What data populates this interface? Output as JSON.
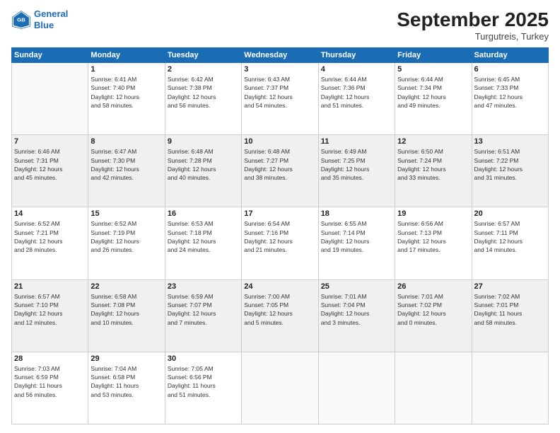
{
  "header": {
    "logo_line1": "General",
    "logo_line2": "Blue",
    "month": "September 2025",
    "location": "Turgutreis, Turkey"
  },
  "weekdays": [
    "Sunday",
    "Monday",
    "Tuesday",
    "Wednesday",
    "Thursday",
    "Friday",
    "Saturday"
  ],
  "weeks": [
    [
      {
        "day": "",
        "info": ""
      },
      {
        "day": "1",
        "info": "Sunrise: 6:41 AM\nSunset: 7:40 PM\nDaylight: 12 hours\nand 58 minutes."
      },
      {
        "day": "2",
        "info": "Sunrise: 6:42 AM\nSunset: 7:38 PM\nDaylight: 12 hours\nand 56 minutes."
      },
      {
        "day": "3",
        "info": "Sunrise: 6:43 AM\nSunset: 7:37 PM\nDaylight: 12 hours\nand 54 minutes."
      },
      {
        "day": "4",
        "info": "Sunrise: 6:44 AM\nSunset: 7:36 PM\nDaylight: 12 hours\nand 51 minutes."
      },
      {
        "day": "5",
        "info": "Sunrise: 6:44 AM\nSunset: 7:34 PM\nDaylight: 12 hours\nand 49 minutes."
      },
      {
        "day": "6",
        "info": "Sunrise: 6:45 AM\nSunset: 7:33 PM\nDaylight: 12 hours\nand 47 minutes."
      }
    ],
    [
      {
        "day": "7",
        "info": "Sunrise: 6:46 AM\nSunset: 7:31 PM\nDaylight: 12 hours\nand 45 minutes."
      },
      {
        "day": "8",
        "info": "Sunrise: 6:47 AM\nSunset: 7:30 PM\nDaylight: 12 hours\nand 42 minutes."
      },
      {
        "day": "9",
        "info": "Sunrise: 6:48 AM\nSunset: 7:28 PM\nDaylight: 12 hours\nand 40 minutes."
      },
      {
        "day": "10",
        "info": "Sunrise: 6:48 AM\nSunset: 7:27 PM\nDaylight: 12 hours\nand 38 minutes."
      },
      {
        "day": "11",
        "info": "Sunrise: 6:49 AM\nSunset: 7:25 PM\nDaylight: 12 hours\nand 35 minutes."
      },
      {
        "day": "12",
        "info": "Sunrise: 6:50 AM\nSunset: 7:24 PM\nDaylight: 12 hours\nand 33 minutes."
      },
      {
        "day": "13",
        "info": "Sunrise: 6:51 AM\nSunset: 7:22 PM\nDaylight: 12 hours\nand 31 minutes."
      }
    ],
    [
      {
        "day": "14",
        "info": "Sunrise: 6:52 AM\nSunset: 7:21 PM\nDaylight: 12 hours\nand 28 minutes."
      },
      {
        "day": "15",
        "info": "Sunrise: 6:52 AM\nSunset: 7:19 PM\nDaylight: 12 hours\nand 26 minutes."
      },
      {
        "day": "16",
        "info": "Sunrise: 6:53 AM\nSunset: 7:18 PM\nDaylight: 12 hours\nand 24 minutes."
      },
      {
        "day": "17",
        "info": "Sunrise: 6:54 AM\nSunset: 7:16 PM\nDaylight: 12 hours\nand 21 minutes."
      },
      {
        "day": "18",
        "info": "Sunrise: 6:55 AM\nSunset: 7:14 PM\nDaylight: 12 hours\nand 19 minutes."
      },
      {
        "day": "19",
        "info": "Sunrise: 6:56 AM\nSunset: 7:13 PM\nDaylight: 12 hours\nand 17 minutes."
      },
      {
        "day": "20",
        "info": "Sunrise: 6:57 AM\nSunset: 7:11 PM\nDaylight: 12 hours\nand 14 minutes."
      }
    ],
    [
      {
        "day": "21",
        "info": "Sunrise: 6:57 AM\nSunset: 7:10 PM\nDaylight: 12 hours\nand 12 minutes."
      },
      {
        "day": "22",
        "info": "Sunrise: 6:58 AM\nSunset: 7:08 PM\nDaylight: 12 hours\nand 10 minutes."
      },
      {
        "day": "23",
        "info": "Sunrise: 6:59 AM\nSunset: 7:07 PM\nDaylight: 12 hours\nand 7 minutes."
      },
      {
        "day": "24",
        "info": "Sunrise: 7:00 AM\nSunset: 7:05 PM\nDaylight: 12 hours\nand 5 minutes."
      },
      {
        "day": "25",
        "info": "Sunrise: 7:01 AM\nSunset: 7:04 PM\nDaylight: 12 hours\nand 3 minutes."
      },
      {
        "day": "26",
        "info": "Sunrise: 7:01 AM\nSunset: 7:02 PM\nDaylight: 12 hours\nand 0 minutes."
      },
      {
        "day": "27",
        "info": "Sunrise: 7:02 AM\nSunset: 7:01 PM\nDaylight: 11 hours\nand 58 minutes."
      }
    ],
    [
      {
        "day": "28",
        "info": "Sunrise: 7:03 AM\nSunset: 6:59 PM\nDaylight: 11 hours\nand 56 minutes."
      },
      {
        "day": "29",
        "info": "Sunrise: 7:04 AM\nSunset: 6:58 PM\nDaylight: 11 hours\nand 53 minutes."
      },
      {
        "day": "30",
        "info": "Sunrise: 7:05 AM\nSunset: 6:56 PM\nDaylight: 11 hours\nand 51 minutes."
      },
      {
        "day": "",
        "info": ""
      },
      {
        "day": "",
        "info": ""
      },
      {
        "day": "",
        "info": ""
      },
      {
        "day": "",
        "info": ""
      }
    ]
  ]
}
